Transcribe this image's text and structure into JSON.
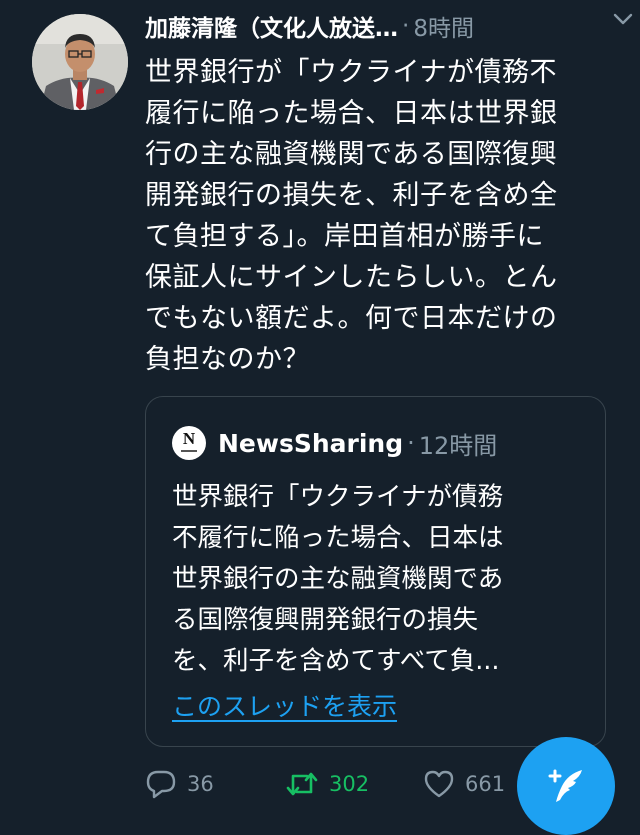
{
  "tweet": {
    "display_name": "加藤清隆（文化人放送…",
    "separator": "·",
    "time": "8時間",
    "text": "世界銀行が「ウクライナが債務不\n履行に陥った場合、日本は世界銀\n行の主な融資機関である国際復興\n開発銀行の損失を、利子を含め全\nて負担する」。岸田首相が勝手に\n保証人にサインしたらしい。とん\nでもない額だよ。何で日本だけの\n負担なのか？",
    "avatar_icon": "profile-photo",
    "menu_icon": "chevron-down-icon"
  },
  "quote": {
    "avatar_letter": "N",
    "name": "NewsSharing",
    "separator": "·",
    "time": "12時間",
    "text": "世界銀行「ウクライナが債務\n不履行に陥った場合、日本は\n世界銀行の主な融資機関であ\nる国際復興開発銀行の損失\nを、利子を含めてすべて負...",
    "thread_link": "このスレッドを表示"
  },
  "actions": {
    "reply_count": "36",
    "retweet_count": "302",
    "like_count": "661",
    "reply_icon": "reply-icon",
    "retweet_icon": "retweet-icon",
    "like_icon": "heart-icon",
    "compose_icon": "compose-tweet-icon"
  },
  "colors": {
    "background": "#15202b",
    "text": "#ffffff",
    "secondary": "#8899a6",
    "accent": "#1da1f2",
    "retweet_active": "#17bf63",
    "border": "#38444d"
  }
}
